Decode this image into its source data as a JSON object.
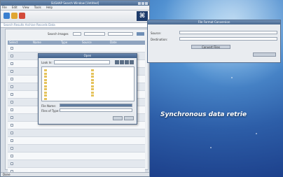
{
  "desktop": {
    "tagline": "Synchronous data retrie"
  },
  "main_window": {
    "title": "SUSHAP Search Window [Untitled]",
    "menu": [
      "File",
      "Edit",
      "View",
      "Tools",
      "Help"
    ],
    "address": "Search  Results  Archive  Records  Data",
    "pager_label": "Search Images",
    "columns": [
      "Select",
      "Name",
      "Type",
      "Source",
      "Date"
    ],
    "rows": [
      {
        "name": "",
        "type": "",
        "source": "",
        "date": ""
      },
      {
        "name": "",
        "type": "",
        "source": "",
        "date": ""
      },
      {
        "name": "",
        "type": "",
        "source": "",
        "date": ""
      },
      {
        "name": "",
        "type": "",
        "source": "",
        "date": ""
      },
      {
        "name": "",
        "type": "",
        "source": "",
        "date": ""
      },
      {
        "name": "",
        "type": "",
        "source": "",
        "date": ""
      },
      {
        "name": "",
        "type": "",
        "source": "",
        "date": ""
      },
      {
        "name": "",
        "type": "",
        "source": "",
        "date": ""
      },
      {
        "name": "",
        "type": "",
        "source": "",
        "date": ""
      },
      {
        "name": "",
        "type": "",
        "source": "",
        "date": ""
      },
      {
        "name": "",
        "type": "",
        "source": "",
        "date": ""
      },
      {
        "name": "",
        "type": "",
        "source": "",
        "date": ""
      },
      {
        "name": "",
        "type": "",
        "source": "",
        "date": ""
      },
      {
        "name": "",
        "type": "",
        "source": "",
        "date": ""
      },
      {
        "name": "",
        "type": "",
        "source": "",
        "date": ""
      },
      {
        "name": "",
        "type": "",
        "source": "",
        "date": ""
      },
      {
        "name": "",
        "type": "",
        "source": "",
        "date": ""
      }
    ],
    "status": "Done"
  },
  "file_dialog": {
    "title": "Open",
    "look_in_label": "Look In:",
    "file_name_label": "File Name:",
    "file_type_label": "Files of Type:",
    "open_label": "",
    "cancel_label": ""
  },
  "settings_window": {
    "title": "File Format Conversion",
    "field1_label": "Source:",
    "field2_label": "Destination:",
    "convert_label": "Convert Files",
    "close_label": ""
  },
  "colors": {
    "desktop": "#2d5ea8",
    "window_frame": "#48688f",
    "table_header": "#8fa4bf"
  }
}
